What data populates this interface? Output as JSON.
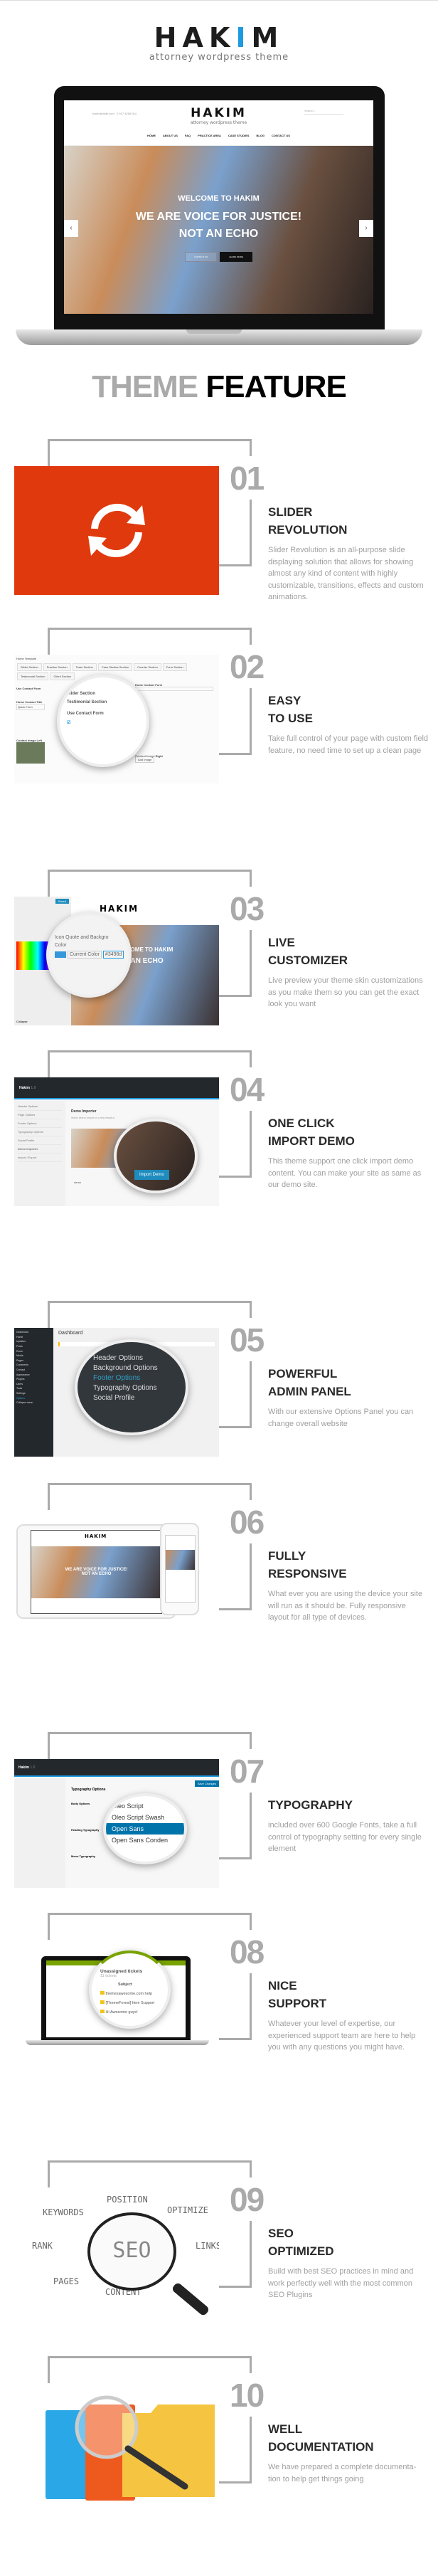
{
  "header": {
    "logo_name": "HAKIM",
    "logo_tagline": "attorney wordpress theme"
  },
  "laptop_site": {
    "logo": "HAKIM",
    "tagline": "attorney wordpress theme",
    "email": "hakim@mail.com",
    "phone": "0 917 4268 044",
    "search_placeholder": "Search...",
    "nav": [
      "HOME",
      "ABOUT US",
      "FAQ",
      "PRACTICE AREA",
      "CASE STUDIES",
      "BLOG",
      "CONTACT US"
    ],
    "welcome": "WELCOME TO HAKIM",
    "headline_1": "WE ARE VOICE FOR JUSTICE!",
    "headline_2": "NOT AN ECHO",
    "btn_contact": "CONTACT US",
    "btn_learn": "LEARN MORE",
    "prev": "‹",
    "next": "›"
  },
  "section_title": {
    "gray": "THEME",
    "black": "FEATURE"
  },
  "colors": {
    "slider_bg": "#e0390e",
    "accent_blue": "#1e9be0",
    "number_gray": "#aaaaaa",
    "title": "#2a2a2a"
  },
  "features": [
    {
      "num": "01",
      "title": [
        "SLIDER",
        "REVOLUTION"
      ],
      "desc": "Slider Revolution is an all-purpose slide displaying solution that allows for showing almost any kind of content with highly customizable, transitions, effects and custom animations.",
      "icon": "refresh-icon"
    },
    {
      "num": "02",
      "title": [
        "EASY",
        "TO USE"
      ],
      "desc": "Take full control of your page with custom field feature, no need time to set up a clean page",
      "shot": {
        "heading": "Home Template",
        "tabs": [
          "Slider Section",
          "Practice Section",
          "Team Section",
          "Case Studies Section",
          "Counter Section",
          "Form Section",
          "Testimonial Section",
          "Client Section"
        ],
        "label": "Use Contact Form",
        "label2": "Home Contact Title",
        "value2": "Quick Form",
        "label3": "Home Contact Form",
        "label4": "Contact Image Left",
        "label5": "Contact Image Right",
        "add": "Add Image"
      }
    },
    {
      "num": "03",
      "title": [
        "LIVE",
        "CUSTOMIZER"
      ],
      "desc": "Live preview your theme skin customizations as you make them so you can get the exact look you want",
      "shot": {
        "lens_1": "Icon Quote and Backgro",
        "lens_2": "Color",
        "lens_btn": "Current Color",
        "lens_val": "#3498d",
        "save": "Saved",
        "collapse": "Collapse"
      }
    },
    {
      "num": "04",
      "title": [
        "ONE CLICK",
        "IMPORT DEMO"
      ],
      "desc": "This theme support one click import demo content. You can make your site as same as our demo site.",
      "shot": {
        "brand": "Hakim",
        "version": "1.0",
        "menu": [
          "Header Options",
          "Page Options",
          "Footer Options",
          "Typography Options",
          "Social Profile",
          "Demo Importer",
          "Import / Export"
        ],
        "heading": "Demo Importer",
        "hint": "Works best to import on a new install of",
        "demo": "demo",
        "import": "Import Demo"
      }
    },
    {
      "num": "05",
      "title": [
        "POWERFUL",
        "ADMIN PANEL"
      ],
      "desc": "With our extensive Options Panel you can change overall website",
      "shot": {
        "heading": "Dashboard",
        "menu": [
          "Dashboard",
          "Home",
          "Updates",
          "Posts",
          "Room",
          "Media",
          "Pages",
          "Comments",
          "Contact",
          "Appearance",
          "Plugins",
          "Users",
          "Tools",
          "Settings",
          "Options",
          "Collapse menu"
        ],
        "lens": [
          "Header Options",
          "Background Options",
          "Footer Options",
          "Typography Options",
          "Social Profile"
        ]
      }
    },
    {
      "num": "06",
      "title": [
        "FULLY",
        "RESPONSIVE"
      ],
      "desc": "What ever you are using the device your site will run as it should be. Fully responsive layout for all type of devices.",
      "shot": {
        "logo": "HAKIM",
        "headline": "WE ARE VOICE FOR JUSTICE!",
        "sub": "NOT AN ECHO"
      }
    },
    {
      "num": "07",
      "title": [
        "TYPOGRAPHY"
      ],
      "desc": "included over 600 Google Fonts, take a full control of typography setting for every single element",
      "shot": {
        "brand": "Hakim",
        "version": "1.0",
        "heading": "Typography Options",
        "save": "Save Changes",
        "fonts": [
          "Oleo Script",
          "Oleo Script Swash",
          "Open Sans",
          "Open Sans Conden"
        ],
        "labels": [
          "Body Options",
          "Heading Typography",
          "Menu Typography"
        ]
      }
    },
    {
      "num": "08",
      "title": [
        "NICE",
        "SUPPORT"
      ],
      "desc": "Whatever your level of expertise, our experienced support team are here to help you with any questions you might have.",
      "shot": {
        "heading": "Unassigned tickets",
        "count": "11 tickets",
        "col": "Subject",
        "rows": [
          "themesawesome.com help",
          "[ThemeForest] Item Support",
          "Hi Awesome guys!"
        ]
      }
    },
    {
      "num": "09",
      "title": [
        "SEO",
        "OPTIMIZED"
      ],
      "desc": "Build with best SEO practices in mind and work perfectly well with the most common SEO Plugins",
      "shot": {
        "center": "SEO",
        "words": [
          "POSITION",
          "KEYWORDS",
          "OPTIMIZE",
          "RANK",
          "LINKS",
          "PAGES",
          "CONTENT"
        ]
      }
    },
    {
      "num": "10",
      "title": [
        "WELL",
        "DOCUMENTATION"
      ],
      "desc": "We have prepared a complete documenta-tion to help get things going",
      "icon": "folders-magnifier-icon"
    }
  ]
}
